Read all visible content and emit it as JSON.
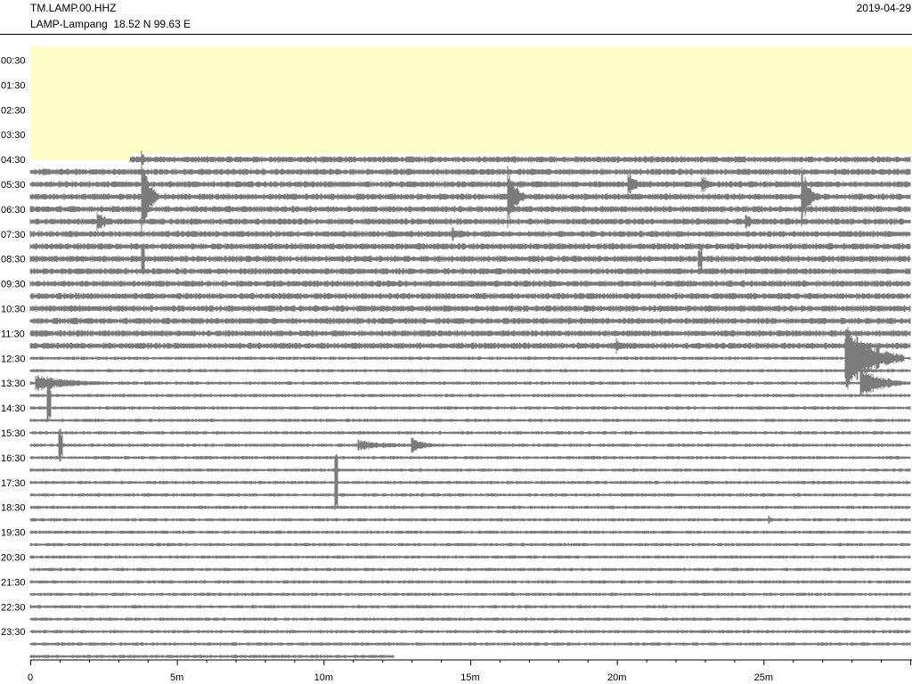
{
  "header": {
    "station_code": "TM.LAMP.00.HHZ",
    "station_desc": "LAMP-Lampang  18.52 N 99.63 E",
    "date": "2019-04-29"
  },
  "colors": {
    "trace": "#7b7b7b",
    "no_data": "#fffdc8",
    "axis": "#000000"
  },
  "chart_data": {
    "type": "helicorder",
    "row_minutes": 30,
    "row_labels": [
      "00:30",
      "01:30",
      "02:30",
      "03:30",
      "04:30",
      "05:30",
      "06:30",
      "07:30",
      "08:30",
      "09:30",
      "10:30",
      "11:30",
      "12:30",
      "13:30",
      "14:30",
      "15:30",
      "16:30",
      "17:30",
      "18:30",
      "19:30",
      "20:30",
      "21:30",
      "22:30",
      "23:30"
    ],
    "x_ticks": [
      "0",
      "5m",
      "10m",
      "15m",
      "20m",
      "25m"
    ],
    "x_tick_values": [
      0,
      5,
      10,
      15,
      20,
      25
    ],
    "xlim": [
      0,
      30
    ],
    "trace_count": 50,
    "data_start_minute": 3.4,
    "data_end_minute": 12.4,
    "events": [
      {
        "trace": 0,
        "minute": 3.3,
        "amp": 46,
        "width": 0.1
      },
      {
        "trace": 0,
        "minute": 3.8,
        "amp": 12,
        "width": 0.2
      },
      {
        "trace": 3,
        "minute": 3.8,
        "amp": 45,
        "width": 0.6
      },
      {
        "trace": 3,
        "minute": 16.3,
        "amp": 35,
        "width": 0.6
      },
      {
        "trace": 3,
        "minute": 26.3,
        "amp": 35,
        "width": 0.6
      },
      {
        "trace": 2,
        "minute": 20.4,
        "amp": 14,
        "width": 0.6
      },
      {
        "trace": 2,
        "minute": 22.9,
        "amp": 12,
        "width": 0.6
      },
      {
        "trace": 5,
        "minute": 2.3,
        "amp": 12,
        "width": 0.8
      },
      {
        "trace": 5,
        "minute": 24.4,
        "amp": 10,
        "width": 0.5
      },
      {
        "trace": 6,
        "minute": 14.4,
        "amp": 8,
        "width": 1.0
      },
      {
        "trace": 8,
        "minute": 3.8,
        "amp": 20,
        "width": 0.1
      },
      {
        "trace": 8,
        "minute": 22.8,
        "amp": 16,
        "width": 0.1
      },
      {
        "trace": 15,
        "minute": 20.0,
        "amp": 8,
        "width": 0.5
      },
      {
        "trace": 16,
        "minute": 27.8,
        "amp": 40,
        "width": 2.0
      },
      {
        "trace": 18,
        "minute": 0.2,
        "amp": 10,
        "width": 3.0
      },
      {
        "trace": 18,
        "minute": 28.3,
        "amp": 18,
        "width": 1.7
      },
      {
        "trace": 19,
        "minute": 0.6,
        "amp": 10,
        "width": 0.1
      },
      {
        "trace": 20,
        "minute": 0.6,
        "amp": 15,
        "width": 0.1
      },
      {
        "trace": 23,
        "minute": 1.0,
        "amp": 20,
        "width": 0.1
      },
      {
        "trace": 23,
        "minute": 11.2,
        "amp": 6,
        "width": 3.0
      },
      {
        "trace": 23,
        "minute": 13.0,
        "amp": 10,
        "width": 1.0
      },
      {
        "trace": 25,
        "minute": 10.4,
        "amp": 20,
        "width": 0.1
      },
      {
        "trace": 27,
        "minute": 10.4,
        "amp": 20,
        "width": 0.1
      },
      {
        "trace": 29,
        "minute": 25.2,
        "amp": 5,
        "width": 0.3
      },
      {
        "trace": 49,
        "minute": 0.3,
        "amp": 6,
        "width": 0.8
      }
    ]
  }
}
